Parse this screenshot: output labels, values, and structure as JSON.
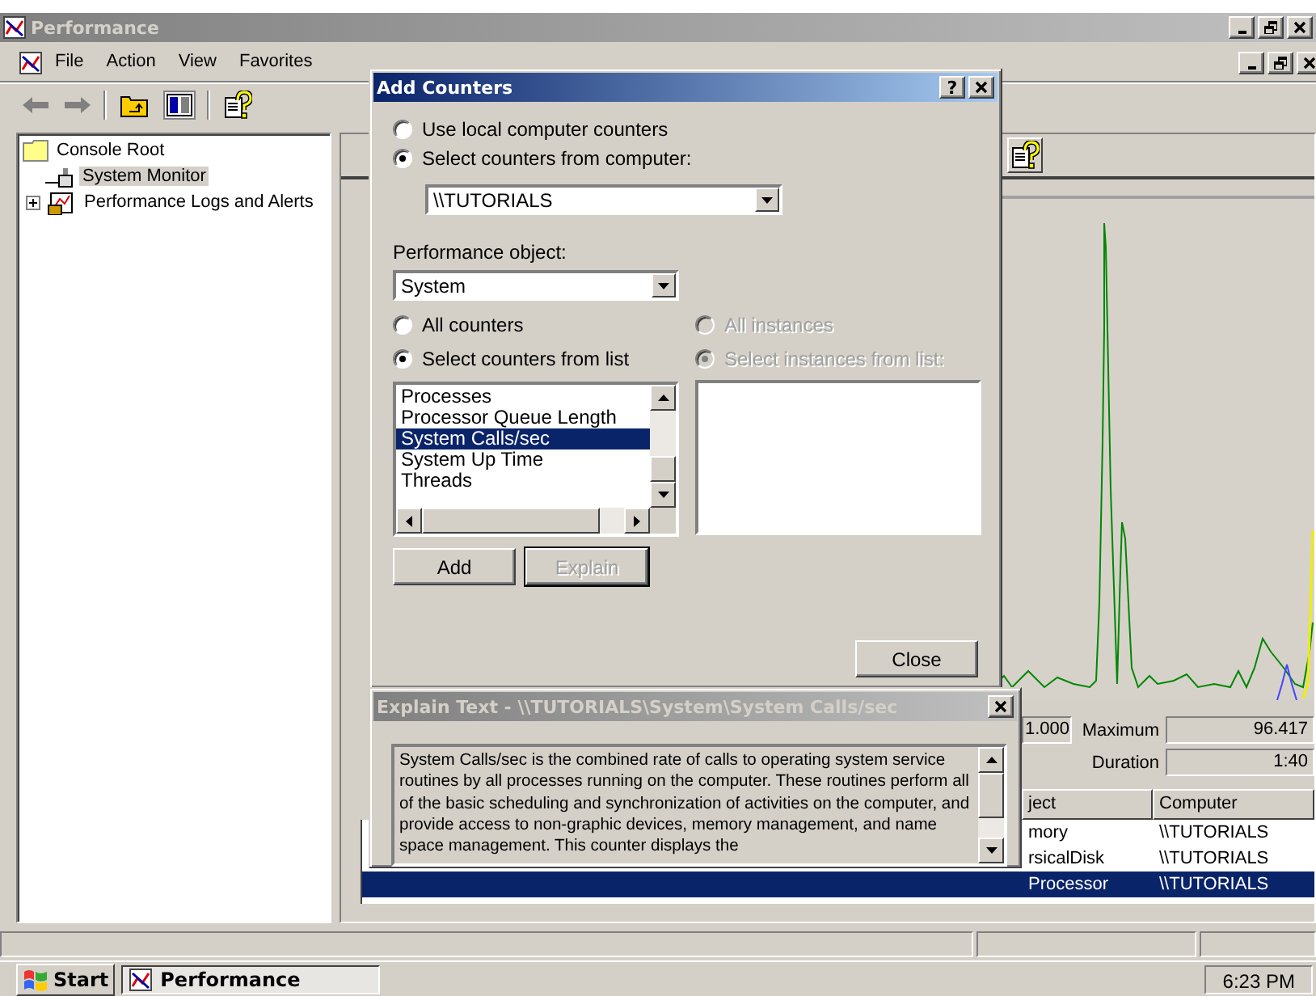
{
  "main_window": {
    "title": "Performance",
    "menu": [
      "File",
      "Action",
      "View",
      "Favorites"
    ],
    "tree": [
      {
        "label": "Console Root",
        "selected": false,
        "children": [
          {
            "label": "System Monitor",
            "selected": true,
            "kind": "monitor"
          },
          {
            "label": "Performance Logs and Alerts",
            "selected": false,
            "kind": "logs",
            "expanded": false
          }
        ]
      }
    ],
    "statistics": [
      {
        "value": "1.000"
      },
      {
        "label": "Maximum",
        "value": "96.417"
      },
      {
        "label": "Duration",
        "value": "1:40"
      }
    ],
    "counter_table": {
      "columns": [
        "ject",
        "Computer"
      ],
      "rows": [
        {
          "cells": [
            "mory",
            "\\\\TUTORIALS"
          ],
          "selected": false
        },
        {
          "cells": [
            "rsicalDisk",
            "\\\\TUTORIALS"
          ],
          "selected": false
        },
        {
          "cells": [
            "Processor",
            "\\\\TUTORIALS"
          ],
          "selected": true
        }
      ]
    }
  },
  "add_counters": {
    "title": "Add Counters",
    "help_button": "?",
    "computer_source": [
      {
        "label": "Use local computer counters",
        "selected": false
      },
      {
        "label": "Select counters from computer:",
        "selected": true
      }
    ],
    "computer": "\\\\TUTORIALS",
    "object_label": "Performance object:",
    "object": "System",
    "counter_mode": [
      {
        "label": "All counters",
        "selected": false,
        "disabled": false
      },
      {
        "label": "Select counters from list",
        "selected": true,
        "disabled": false
      }
    ],
    "instance_mode": [
      {
        "label": "All instances",
        "selected": false,
        "disabled": true
      },
      {
        "label": "Select instances from list:",
        "selected": true,
        "disabled": true
      }
    ],
    "counters": [
      {
        "label": "Processes",
        "selected": false
      },
      {
        "label": "Processor Queue Length",
        "selected": false
      },
      {
        "label": "System Calls/sec",
        "selected": true
      },
      {
        "label": "System Up Time",
        "selected": false
      },
      {
        "label": "Threads",
        "selected": false
      }
    ],
    "buttons": [
      {
        "label": "Add",
        "disabled": false
      },
      {
        "label": "Explain",
        "disabled": true
      }
    ],
    "close_button": "Close"
  },
  "explain": {
    "title": "Explain Text - \\\\TUTORIALS\\System\\System Calls/sec",
    "text": "System Calls/sec is the combined rate of calls to operating system service routines by all processes running on the computer. These routines perform all of the basic scheduling and synchronization of activities on the computer, and provide access to non-graphic devices, memory management, and name space management. This counter displays the"
  },
  "taskbar": {
    "start": "Start",
    "tasks": [
      {
        "label": "Performance",
        "selected": true
      }
    ],
    "clock": "6:23 PM"
  }
}
